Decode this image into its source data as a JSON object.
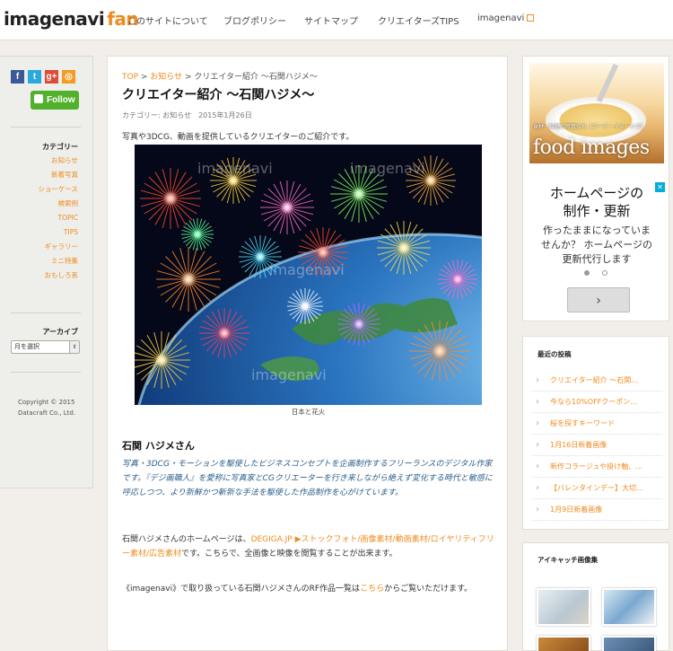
{
  "header": {
    "logo_main": "imagenavi",
    "logo_accent": "fan",
    "nav": [
      {
        "label": "このサイトについて"
      },
      {
        "label": "ブログポリシー"
      },
      {
        "label": "サイトマップ"
      },
      {
        "label": "クリエイターズTIPS"
      },
      {
        "label": "imagenavi"
      }
    ]
  },
  "left_sidebar": {
    "social": [
      {
        "icon": "facebook-icon",
        "glyph": "f",
        "color": "#3b5998"
      },
      {
        "icon": "twitter-icon",
        "glyph": "t",
        "color": "#2aa9e0"
      },
      {
        "icon": "googleplus-icon",
        "glyph": "g+",
        "color": "#dd4b39"
      },
      {
        "icon": "rss-icon",
        "glyph": "◎",
        "color": "#f49b23"
      }
    ],
    "follow_label": "Follow",
    "category_heading": "カテゴリー",
    "categories": [
      "お知らせ",
      "新着写真",
      "ショーケース",
      "検索例",
      "TOPIC",
      "TIPS",
      "ギャラリー",
      "ミニ特集",
      "おもしろ系"
    ],
    "archive_heading": "アーカイブ",
    "archive_select": "月を選択",
    "copyright_line1": "Copyright © 2015",
    "copyright_line2": "Datacraft Co., Ltd."
  },
  "article": {
    "breadcrumb": {
      "top": "TOP",
      "sep1": " > ",
      "category": "お知らせ",
      "sep2": " > ",
      "current": "クリエイター紹介 ～石関ハジメ～"
    },
    "title": "クリエイター紹介 ～石関ハジメ～",
    "meta_category": "カテゴリー: お知らせ",
    "meta_date": "2015年1月26日",
    "intro": "写真や3DCG、動画を提供しているクリエイターのご紹介です。",
    "image_watermark": "imagenavi",
    "image_caption": "日本と花火",
    "artist_name": "石関 ハジメさん",
    "description": "写真・3DCG・モーションを駆使したビジネスコンセプトを企画制作するフリーランスのデジタル作家です。『デジ画職人』を愛称に写真家とCGクリエーターを行き来しながら絶えず変化する時代と敏感に呼応しつつ、より新鮮かつ斬新な手法を駆使した作品制作を心がけています。",
    "homepage_pre": "石関ハジメさんのホームページは、",
    "homepage_link": "DEGIGA.JP ▶ストックフォト/画像素材/動画素材/ロイヤリティフリー素材/広告素材",
    "homepage_post": "です。こちらで、全画像と映像を閲覧することが出来ます。",
    "rf_pre": "《imagenavi》で取り扱っている石関ハジメさんのRF作品一覧は",
    "rf_link": "こちら",
    "rf_post": "からご覧いただけます。"
  },
  "ad": {
    "food_tag": "食材・料理の写真なら［フード・イメージズ］",
    "food_brand": "food images",
    "headline_line1": "ホームページの",
    "headline_line2": "制作・更新",
    "body_line1": "作ったままになっていま",
    "body_line2": "せんか？ ホームページの",
    "body_line3": "更新代行します",
    "next_glyph": "›",
    "close_glyph": "✕"
  },
  "recent": {
    "heading": "最近の投稿",
    "items": [
      "クリエイター紹介 ～石関…",
      "今なら10%OFFクーポン…",
      "桜を探すキーワード",
      "1月16日新着画像",
      "新作コラージュや掛け軸、…",
      "【バレンタインデー】大切…",
      "1月9日新着画像"
    ]
  },
  "eyecatch": {
    "heading": "アイキャッチ画像集"
  },
  "colors": {
    "accent": "#f08b1f",
    "description_text": "#2d5f8a",
    "follow_green": "#52b12a"
  }
}
